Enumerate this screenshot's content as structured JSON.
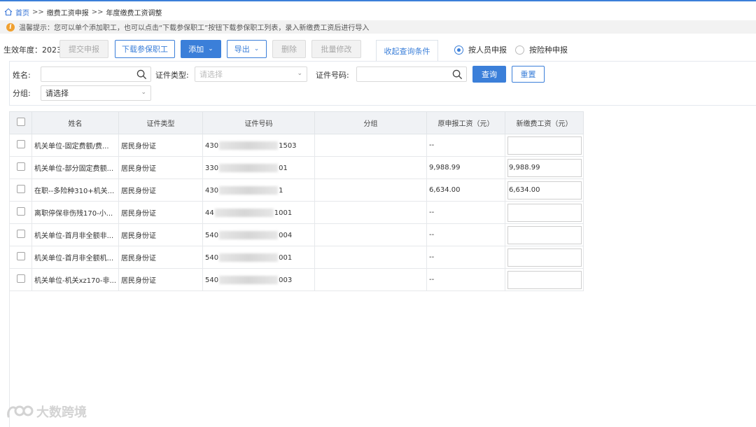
{
  "breadcrumb": {
    "home": "首页",
    "sep": ">>",
    "level1": "缴费工资申报",
    "level2": "年度缴费工资调整"
  },
  "tip": {
    "icon": "info-icon",
    "text": "温馨提示：您可以单个添加职工，也可以点击“下载参保职工”按钮下载参保职工列表，录入新缴费工资后进行导入"
  },
  "toolbar": {
    "year_label": "生效年度：",
    "year_value": "2023",
    "submit": "提交申报",
    "download": "下载参保职工",
    "add": "添加",
    "export": "导出",
    "delete": "删除",
    "batch_edit": "批量修改",
    "collapse": "收起查询条件",
    "radio_person": "按人员申报",
    "radio_insurance": "按险种申报"
  },
  "filter": {
    "name_label": "姓名:",
    "id_type_label": "证件类型:",
    "id_type_placeholder": "请选择",
    "id_number_label": "证件号码:",
    "query": "查询",
    "reset": "重置",
    "group_label": "分组:",
    "group_value": "请选择"
  },
  "table": {
    "headers": [
      "姓名",
      "证件类型",
      "证件号码",
      "分组",
      "原申报工资（元）",
      "新缴费工资（元）"
    ],
    "rows": [
      {
        "name": "机关单位-固定费额/费...",
        "id_type": "居民身份证",
        "id_prefix": "430",
        "id_suffix": "1503",
        "group": "",
        "orig": "--",
        "new": ""
      },
      {
        "name": "机关单位-部分固定费额...",
        "id_type": "居民身份证",
        "id_prefix": "330",
        "id_suffix": "01",
        "group": "",
        "orig": "9,988.99",
        "new": "9,988.99"
      },
      {
        "name": "在职--多险种310+机关...",
        "id_type": "居民身份证",
        "id_prefix": "430",
        "id_suffix": "1",
        "group": "",
        "orig": "6,634.00",
        "new": "6,634.00"
      },
      {
        "name": "离职停保非伤残170-小...",
        "id_type": "居民身份证",
        "id_prefix": "44",
        "id_suffix": "1001",
        "group": "",
        "orig": "--",
        "new": ""
      },
      {
        "name": "机关单位-首月非全额非...",
        "id_type": "居民身份证",
        "id_prefix": "540",
        "id_suffix": "004",
        "group": "",
        "orig": "--",
        "new": ""
      },
      {
        "name": "机关单位-首月非全额机...",
        "id_type": "居民身份证",
        "id_prefix": "540",
        "id_suffix": "001",
        "group": "",
        "orig": "--",
        "new": ""
      },
      {
        "name": "机关单位-机关xz170-非...",
        "id_type": "居民身份证",
        "id_prefix": "540",
        "id_suffix": "003",
        "group": "",
        "orig": "--",
        "new": ""
      }
    ]
  },
  "watermark": {
    "text": "大数跨境"
  },
  "colors": {
    "primary": "#3b7fd9",
    "warning": "#f0a030"
  }
}
